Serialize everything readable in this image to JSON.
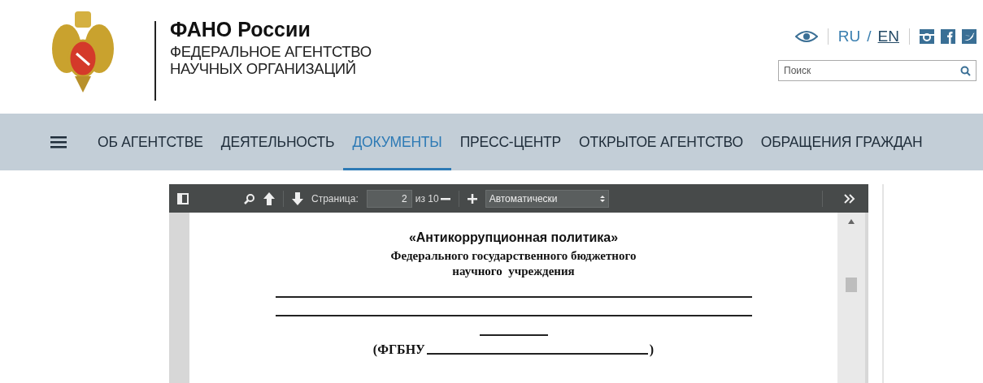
{
  "header": {
    "title": "ФАНО России",
    "subtitle_lines": [
      "ФЕДЕРАЛЬНОЕ АГЕНТСТВО",
      "НАУЧНЫХ ОРГАНИЗАЦИЙ"
    ]
  },
  "languages": [
    {
      "label": "RU",
      "selected": true
    },
    {
      "label": "EN",
      "selected": false
    }
  ],
  "language_separator": "/",
  "search": {
    "placeholder": "Поиск"
  },
  "nav": [
    {
      "label": "ОБ АГЕНТСТВЕ",
      "selected": false
    },
    {
      "label": "ДЕЯТЕЛЬНОСТЬ",
      "selected": false
    },
    {
      "label": "ДОКУМЕНТЫ",
      "selected": true
    },
    {
      "label": "ПРЕСС-ЦЕНТР",
      "selected": false
    },
    {
      "label": "ОТКРЫТОЕ АГЕНТСТВО",
      "selected": false
    },
    {
      "label": "ОБРАЩЕНИЯ ГРАЖДАН",
      "selected": false
    }
  ],
  "viewer": {
    "page_label": "Страница:",
    "page_value": "2",
    "page_total": "из 10",
    "zoom": "Автоматически",
    "document": {
      "title": "«Антикоррупционная политика»",
      "subtitle_lines": [
        "Федерального государственного бюджетного",
        "научного  учреждения"
      ],
      "org_prefix": "(ФГБНУ",
      "org_suffix": ")"
    }
  }
}
